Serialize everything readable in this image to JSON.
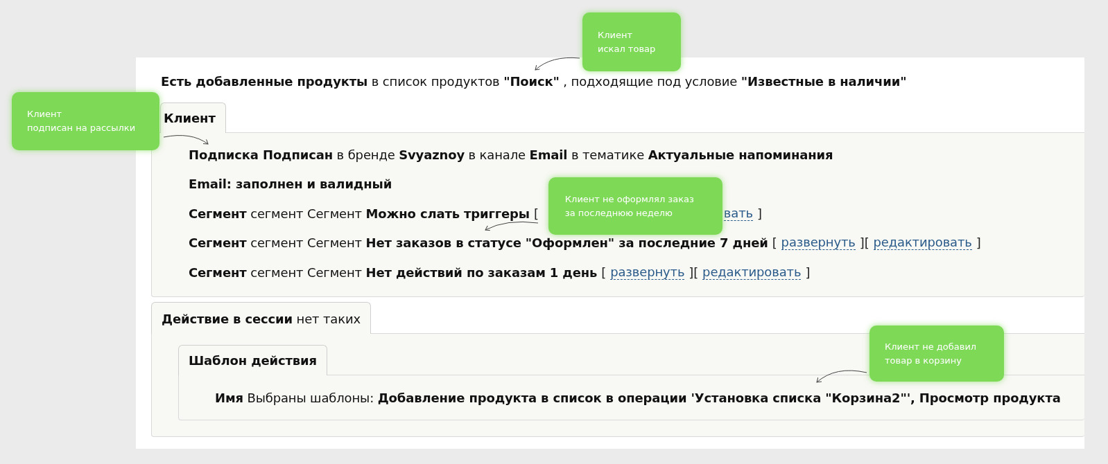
{
  "condition": {
    "text": "**Есть добавленные продукты** в список продуктов **\"Поиск\"** , подходящие под условие **\"Известные в наличии\"**"
  },
  "client": {
    "tab": "Клиент",
    "rows": [
      {
        "text": "**Подписка Подписан** в бренде **Svyaznoy** в канале **Email** в тематике **Актуальные напоминания**",
        "tail": []
      },
      {
        "text": "**Email: заполнен и валидный**",
        "tail": []
      },
      {
        "text": "**Сегмент** сегмент Сегмент **Можно слать триггеры**",
        "tail": [
          {
            "kind": "bracket",
            "text": "["
          },
          {
            "kind": "callout",
            "lines": [
              "Клиент не оформлял заказ",
              "за последнюю неделю"
            ]
          },
          {
            "kind": "link",
            "text": "вать"
          },
          {
            "kind": "bracket",
            "text": "]"
          }
        ]
      },
      {
        "text": "**Сегмент** сегмент Сегмент **Нет заказов в статусе \"Оформлен\" за последние 7 дней**",
        "tail": [
          {
            "kind": "bracket",
            "text": "["
          },
          {
            "kind": "link",
            "text": "развернуть"
          },
          {
            "kind": "bracket",
            "text": "]["
          },
          {
            "kind": "link",
            "text": "редактировать"
          },
          {
            "kind": "bracket",
            "text": "]"
          }
        ]
      },
      {
        "text": "**Сегмент** сегмент Сегмент **Нет действий по заказам 1 день**",
        "tail": [
          {
            "kind": "bracket",
            "text": "["
          },
          {
            "kind": "link",
            "text": "развернуть"
          },
          {
            "kind": "bracket",
            "text": "]["
          },
          {
            "kind": "link",
            "text": "редактировать"
          },
          {
            "kind": "bracket",
            "text": "]"
          }
        ]
      }
    ]
  },
  "session": {
    "tab": "**Действие в сессии** нет таких",
    "template": {
      "tab": "Шаблон действия",
      "rows": [
        {
          "text": "**Имя** Выбраны шаблоны: **Добавление продукта в список в операции 'Установка списка \"Корзина2\"', Просмотр продукта**"
        }
      ]
    }
  },
  "callouts": [
    {
      "lines": [
        "Клиент",
        "искал товар"
      ]
    },
    {
      "lines": [
        "Клиент",
        "подписан на рассылки"
      ]
    },
    {
      "lines": [
        "Клиент не добавил",
        "товар в корзину"
      ]
    }
  ]
}
